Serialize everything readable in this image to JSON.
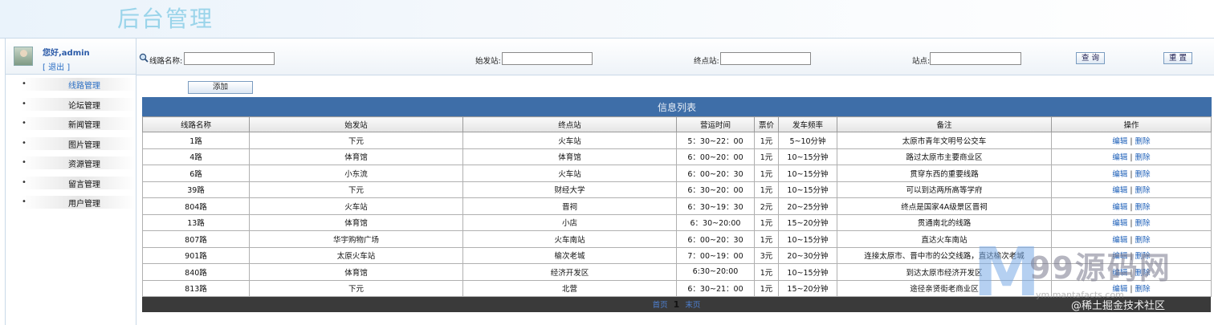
{
  "header": {
    "title": "后台管理"
  },
  "user": {
    "greeting": "您好,admin",
    "logout": "[ 退出 ]"
  },
  "sidebar": {
    "items": [
      {
        "label": "线路管理"
      },
      {
        "label": "论坛管理"
      },
      {
        "label": "新闻管理"
      },
      {
        "label": "图片管理"
      },
      {
        "label": "资源管理"
      },
      {
        "label": "留言管理"
      },
      {
        "label": "用户管理"
      }
    ],
    "bullet": "•"
  },
  "search": {
    "route_label": "线路名称:",
    "start_label": "始发站:",
    "end_label": "终点站:",
    "stop_label": "站点:",
    "route_value": "",
    "start_value": "",
    "end_value": "",
    "stop_value": "",
    "query_button": "查 询",
    "reset_button": "重 置"
  },
  "add_button": "添加",
  "table": {
    "caption": "信息列表",
    "columns": [
      "线路名称",
      "始发站",
      "终点站",
      "营运时间",
      "票价",
      "发车频率",
      "备注",
      "操作"
    ],
    "edit_label": "编辑",
    "delete_label": "删除",
    "separator": "|",
    "rows": [
      [
        "1路",
        "下元",
        "火车站",
        "5：30~22：00",
        "1元",
        "5~10分钟",
        "太原市青年文明号公交车"
      ],
      [
        "4路",
        "体育馆",
        "体育馆",
        "6：00~20：00",
        "1元",
        "10~15分钟",
        "路过太原市主要商业区"
      ],
      [
        "6路",
        "小东流",
        "火车站",
        "6：00~20：30",
        "1元",
        "10~15分钟",
        "贯穿东西的重要线路"
      ],
      [
        "39路",
        "下元",
        "财经大学",
        "6：30~20：00",
        "1元",
        "10~15分钟",
        "可以到达两所高等学府"
      ],
      [
        "804路",
        "火车站",
        "晋祠",
        "6：30~19：30",
        "2元",
        "20~25分钟",
        "终点是国家4A级景区晋祠"
      ],
      [
        "13路",
        "体育馆",
        "小店",
        "6：30~20:00",
        "1元",
        "15~20分钟",
        "贯通南北的线路"
      ],
      [
        "807路",
        "华宇购物广场",
        "火车南站",
        "6：00~20：30",
        "1元",
        "10~15分钟",
        "直达火车南站"
      ],
      [
        "901路",
        "太原火车站",
        "榆次老城",
        "7：00~19：00",
        "3元",
        "20~30分钟",
        "连接太原市、晋中市的公交线路，直达榆次老城"
      ],
      [
        "840路",
        "体育馆",
        "经济开发区",
        "6:30~20:00",
        "1元",
        "10~15分钟",
        "到达太原市经济开发区"
      ],
      [
        "813路",
        "下元",
        "北营",
        "6：30~21：00",
        "1元",
        "15~20分钟",
        "途径亲贤街老商业区"
      ]
    ]
  },
  "pager": {
    "first": "首页",
    "current": "1",
    "last": "末页"
  },
  "watermarks": {
    "brand_letter": "M",
    "brand": "99源码网",
    "url": "ym.mantafacts.com",
    "juejin": "@稀土掘金技术社区"
  }
}
